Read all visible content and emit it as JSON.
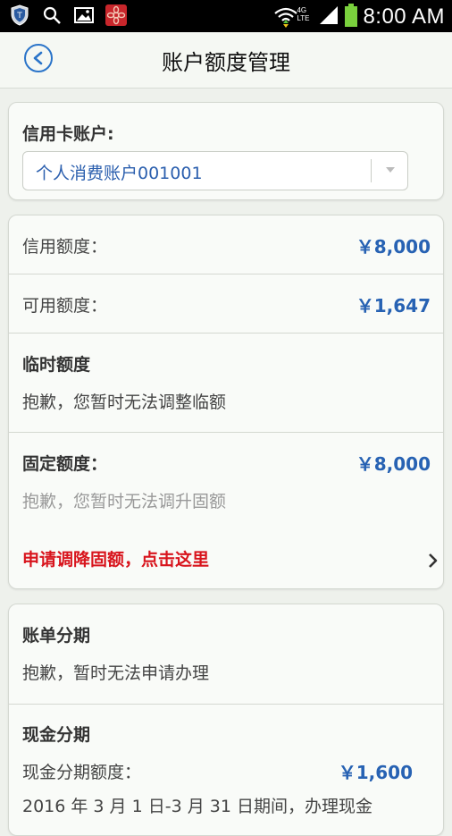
{
  "status_bar": {
    "time": "8:00 AM",
    "network": "4G LTE"
  },
  "header": {
    "title": "账户额度管理"
  },
  "account_card": {
    "label": "信用卡账户:",
    "selected_account": "个人消费账户001001"
  },
  "limits_card": {
    "credit_limit_label": "信用额度：",
    "credit_limit_value": "￥8,000",
    "available_label": "可用额度：",
    "available_value": "￥1,647",
    "temp_title": "临时额度",
    "temp_msg": "抱歉，您暂时无法调整临额",
    "fixed_label": "固定额度：",
    "fixed_value": "￥8,000",
    "fixed_msg": "抱歉，您暂时无法调升固额",
    "reduce_link": "申请调降固额，点击这里"
  },
  "installment_card": {
    "bill_title": "账单分期",
    "bill_msg": "抱歉，暂时无法申请办理",
    "cash_title": "现金分期",
    "cash_limit_label": "现金分期额度：",
    "cash_limit_value": "￥1,600",
    "cash_note": "2016 年 3 月 1 日-3 月 31 日期间，办理现金"
  }
}
